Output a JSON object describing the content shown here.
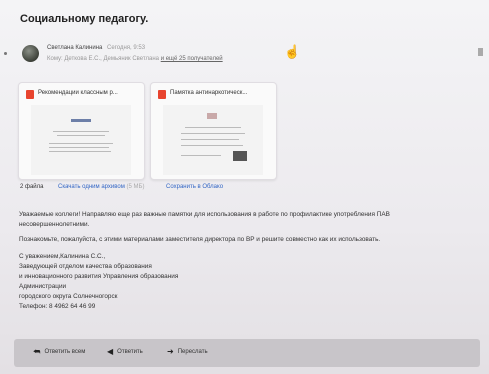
{
  "subject": "Социальному педагогу.",
  "sender": {
    "name": "Светлана Калинина",
    "time": "Сегодня, 9:53",
    "recipients": "Кому: Деткова Е.С., Демьяник Светлана",
    "recipients_more": "и ещё 25 получателей"
  },
  "attachments": [
    {
      "name": "Рекомендации классным р...",
      "icon": "pdf-icon"
    },
    {
      "name": "Памятка антинаркотическ...",
      "icon": "pdf-icon"
    }
  ],
  "attachment_bar": {
    "count": "2 файла",
    "download_all": "Скачать одним архивом",
    "download_size": "(5 МБ)",
    "save_cloud": "Сохранить в Облако"
  },
  "body": {
    "line1": "Уважаемые коллеги! Направляю еще раз важные памятки для использования в работе по профилактике употребления ПАВ",
    "line2": "несовершеннолетними.",
    "line3": "Познакомьте, пожалуйста, с этими материалами заместителя директора по ВР и решите совместно как их использовать.",
    "sig1": "С уважением,Калинина С.С.,",
    "sig2": "Заведующей отделом качества образования",
    "sig3": "и инновационного развития Управления образования",
    "sig4": "Администрации",
    "sig5": "городского округа Солнечногорск",
    "sig6": "Телефон: 8 4962 64 46 99"
  },
  "footer": {
    "reply_all": "Ответить всем",
    "reply": "Ответить",
    "forward": "Переслать"
  }
}
